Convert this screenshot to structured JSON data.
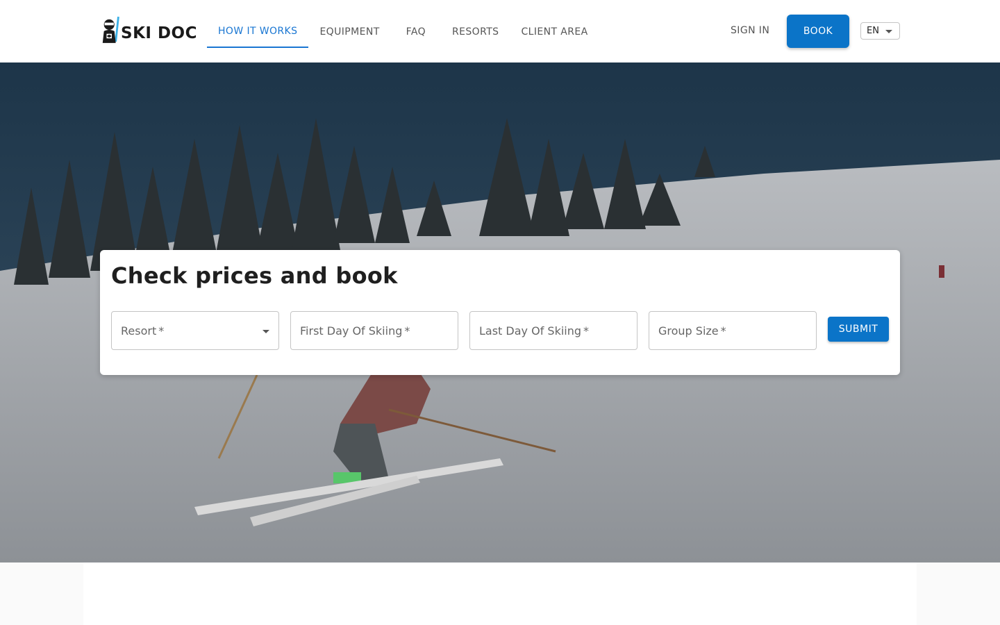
{
  "brand": {
    "name": "SKI DOC",
    "name_prefix": "SKI D",
    "name_o": "O",
    "name_suffix": "C",
    "accent_color": "#1976d2"
  },
  "nav": {
    "items": [
      {
        "label": "HOW IT WORKS",
        "active": true
      },
      {
        "label": "EQUIPMENT",
        "active": false
      },
      {
        "label": "FAQ",
        "active": false
      },
      {
        "label": "RESORTS",
        "active": false
      },
      {
        "label": "CLIENT AREA",
        "active": false
      }
    ]
  },
  "header_actions": {
    "sign_in": "SIGN IN",
    "book": "BOOK",
    "language": "EN"
  },
  "booking": {
    "title": "Check prices and book",
    "fields": {
      "resort": {
        "label": "Resort",
        "required_mark": "*"
      },
      "first_day": {
        "label": "First Day Of Skiing",
        "required_mark": "*"
      },
      "last_day": {
        "label": "Last Day Of Skiing",
        "required_mark": "*"
      },
      "group_size": {
        "label": "Group Size",
        "required_mark": "*"
      }
    },
    "submit": "SUBMIT"
  },
  "colors": {
    "primary_button": "#0b74c8",
    "header_bg": "#ffffff"
  }
}
